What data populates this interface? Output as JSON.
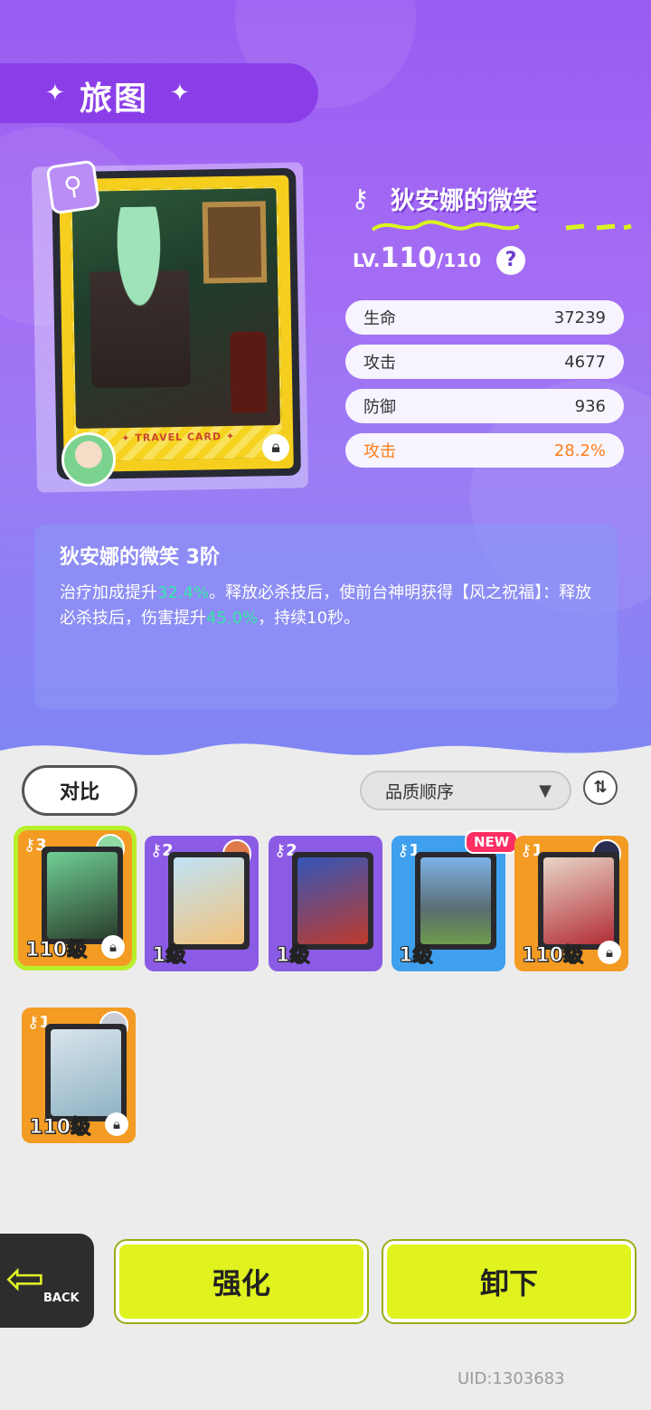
{
  "header": {
    "title": "旅图"
  },
  "card": {
    "name": "狄安娜的微笑",
    "travel_card_label": "✦ TRAVEL CARD ✦",
    "level_prefix": "LV.",
    "level_current": "110",
    "level_max": "/110",
    "stats": [
      {
        "label": "生命",
        "value": "37239"
      },
      {
        "label": "攻击",
        "value": "4677"
      },
      {
        "label": "防御",
        "value": "936"
      },
      {
        "label": "攻击",
        "value": "28.2%",
        "bonus": true
      }
    ]
  },
  "skill": {
    "title": "狄安娜的微笑 3阶",
    "text_1": "治疗加成提升",
    "value_1": "32.4%",
    "text_2": "。释放必杀技后，使前台神明获得【风之祝福】：释放必杀技后，伤害提升",
    "value_2": "45.0%",
    "text_3": "，持续10秒。"
  },
  "controls": {
    "compare_label": "对比",
    "sort_label": "品质顺序",
    "sort_toggle": "⇅"
  },
  "inventory": [
    {
      "rank": "3",
      "level": "110级",
      "color": "orange",
      "selected": true
    },
    {
      "rank": "2",
      "level": "1级",
      "color": "purple"
    },
    {
      "rank": "2",
      "level": "1级",
      "color": "purple"
    },
    {
      "rank": "1",
      "level": "1级",
      "color": "blue",
      "new": "NEW"
    },
    {
      "rank": "1",
      "level": "110级",
      "color": "orange"
    },
    {
      "rank": "1",
      "level": "110级",
      "color": "orange"
    }
  ],
  "footer": {
    "back_label": "BACK",
    "enhance_label": "强化",
    "unequip_label": "卸下",
    "uid": "UID:1303683"
  }
}
